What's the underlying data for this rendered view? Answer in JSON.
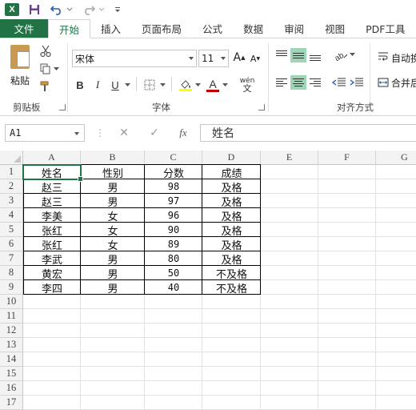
{
  "app": {
    "logo": "X"
  },
  "tabs": [
    "文件",
    "开始",
    "插入",
    "页面布局",
    "公式",
    "数据",
    "审阅",
    "视图",
    "PDF工具"
  ],
  "ribbon": {
    "clipboard": {
      "paste_label": "粘贴",
      "group_label": "剪贴板"
    },
    "font": {
      "family": "宋体",
      "size": "11",
      "group_label": "字体",
      "bold": "B",
      "italic": "I",
      "underline": "U",
      "grow": "A",
      "shrink": "A",
      "fontcolor": "A",
      "phonetic": "wén"
    },
    "alignment": {
      "wrap_label": "自动换",
      "merge_label": "合并后",
      "group_label": "对齐方式"
    }
  },
  "formula_bar": {
    "cell_ref": "A1",
    "fx": "fx",
    "content": "姓名"
  },
  "sheet": {
    "columns": [
      "A",
      "B",
      "C",
      "D",
      "E",
      "F",
      "G"
    ],
    "rows": [
      "1",
      "2",
      "3",
      "4",
      "5",
      "6",
      "7",
      "8",
      "9",
      "10",
      "11",
      "12",
      "13",
      "14",
      "15",
      "16",
      "17"
    ],
    "data": [
      [
        "姓名",
        "性别",
        "分数",
        "成绩"
      ],
      [
        "赵三",
        "男",
        "98",
        "及格"
      ],
      [
        "赵三",
        "男",
        "97",
        "及格"
      ],
      [
        "李美",
        "女",
        "96",
        "及格"
      ],
      [
        "张红",
        "女",
        "90",
        "及格"
      ],
      [
        "张红",
        "女",
        "89",
        "及格"
      ],
      [
        "李武",
        "男",
        "80",
        "及格"
      ],
      [
        "黄宏",
        "男",
        "50",
        "不及格"
      ],
      [
        "李四",
        "男",
        "40",
        "不及格"
      ]
    ]
  },
  "colors": {
    "accent": "#217346",
    "selected_align": "#9fd5b7"
  }
}
